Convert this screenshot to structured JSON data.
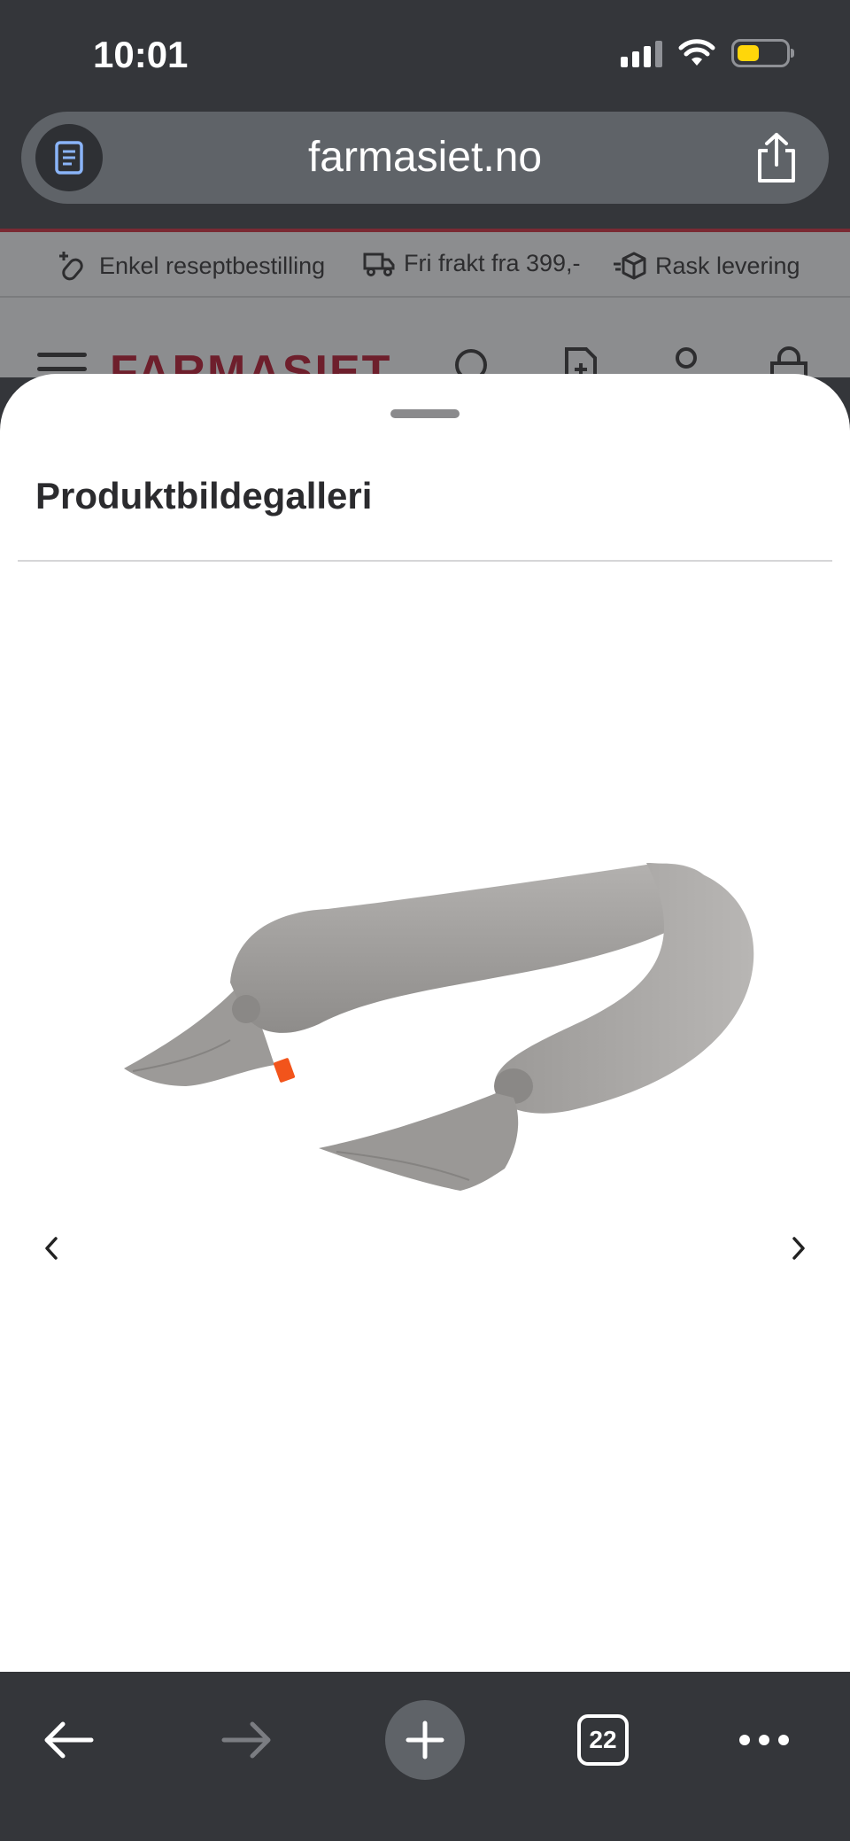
{
  "status_bar": {
    "time": "10:01"
  },
  "browser": {
    "url": "farmasiet.no",
    "tab_count": "22"
  },
  "site": {
    "usp_bar": [
      {
        "icon": "pill-plus-icon",
        "label": "Enkel reseptbestilling"
      },
      {
        "icon": "truck-icon",
        "label": "Fri frakt fra 399,-"
      },
      {
        "icon": "fast-box-icon",
        "label": "Rask levering"
      }
    ],
    "logo": "FARMASIET"
  },
  "sheet": {
    "title": "Produktbildegalleri"
  },
  "colors": {
    "chrome_bg": "#34363a",
    "url_bar": "#5f6368",
    "brand": "#6e1f2c",
    "battery": "#ffd60a",
    "pillow": "#a9a7a5"
  }
}
